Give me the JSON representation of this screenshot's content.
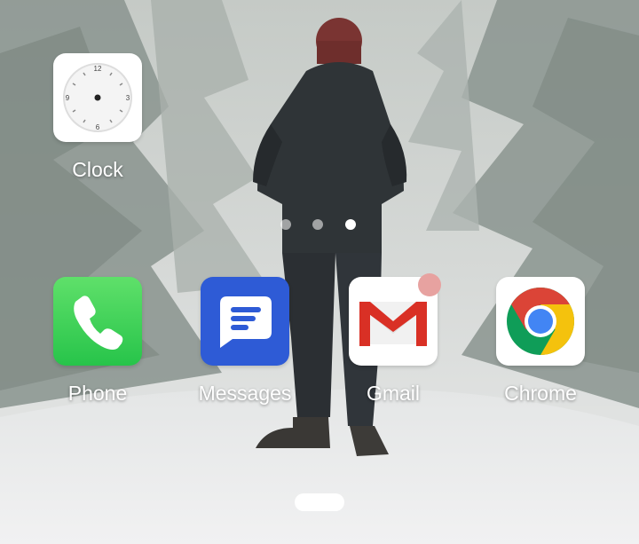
{
  "screen": {
    "wallpaper_icon": "snowy-forest-person-wallpaper"
  },
  "apps": {
    "clock": {
      "label": "Clock",
      "icon": "clock-icon"
    },
    "phone": {
      "label": "Phone",
      "icon": "phone-icon"
    },
    "messages": {
      "label": "Messages",
      "icon": "messages-icon"
    },
    "gmail": {
      "label": "Gmail",
      "icon": "gmail-icon",
      "badge_color": "#e7a2a0"
    },
    "chrome": {
      "label": "Chrome",
      "icon": "chrome-icon"
    }
  },
  "page_indicator": {
    "pages": 3,
    "current_page": 3
  },
  "colors": {
    "phone_green": "#27c44a",
    "messages_blue": "#2e5bd6",
    "gmail_red": "#d93025",
    "chrome_red": "#db4437",
    "chrome_yellow": "#f4c20d",
    "chrome_green": "#0f9d58",
    "chrome_blue": "#4285f4"
  }
}
